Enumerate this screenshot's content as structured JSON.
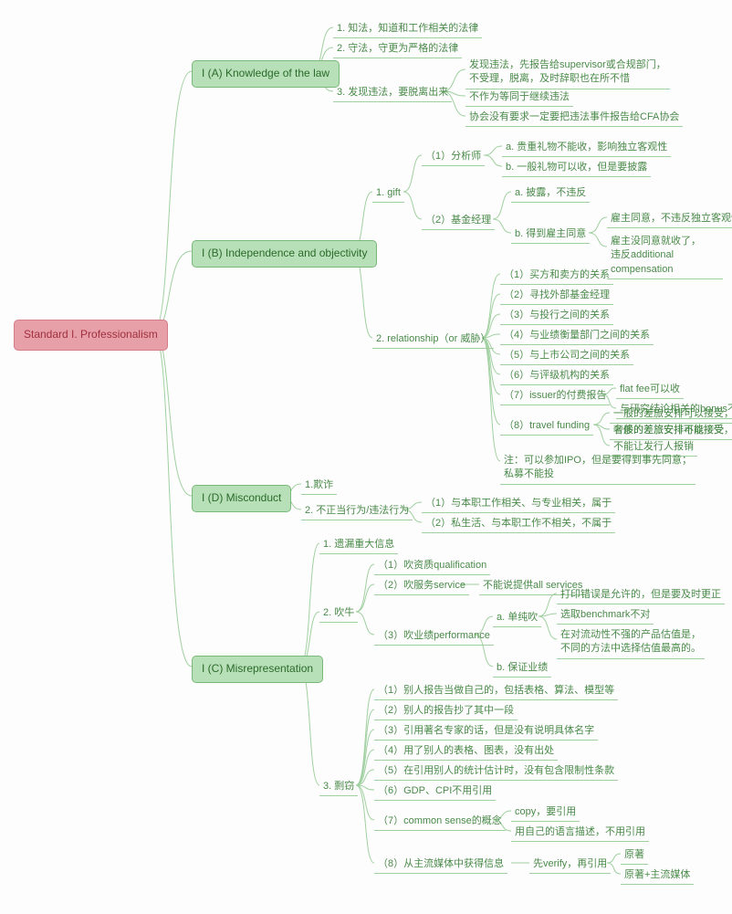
{
  "root": "Standard I. Professionalism",
  "A": {
    "title": "I (A) Knowledge of the law",
    "n1": "1. 知法，知道和工作相关的法律",
    "n2": "2. 守法，守更为严格的法律",
    "n3": "3. 发现违法，要脱离出来",
    "n3a": "发现违法，先报告给supervisor或合规部门，\n不受理，脱离，及时辞职也在所不惜",
    "n3b": "不作为等同于继续违法",
    "n3c": "协会没有要求一定要把违法事件报告给CFA协会"
  },
  "B": {
    "title": "I (B) Independence and objectivity",
    "n1": "1. gift",
    "n1_1": "（1）分析师",
    "n1_1a": "a. 贵重礼物不能收，影响独立客观性",
    "n1_1b": "b. 一般礼物可以收，但是要披露",
    "n1_2": "（2）基金经理",
    "n1_2a": "a. 披露，不违反",
    "n1_2b": "b. 得到雇主同意",
    "n1_2b1": "雇主同意，不违反独立客观性",
    "n1_2b2": "雇主没同意就收了，\n违反additional compensation",
    "n2": "2. relationship（or 威胁）",
    "n2_1": "（1）买方和卖方的关系",
    "n2_2": "（2）寻找外部基金经理",
    "n2_3": "（3）与投行之间的关系",
    "n2_4": "（4）与业绩衡量部门之间的关系",
    "n2_5": "（5）与上市公司之间的关系",
    "n2_6": "（6）与评级机构的关系",
    "n2_7": "（7）issuer的付费报告",
    "n2_7a": "flat fee可以收",
    "n2_7b": "与研究结论相关的bonus不能收",
    "n2_8": "（8）travel funding",
    "n2_8a": "一般的差旅安排可以接受，但要披露",
    "n2_8b": "奢侈的差旅安排不能接受",
    "n2_8c": "不能让发行人报销",
    "n2_9": "注：可以参加IPO，但是要得到事先同意；\n私募不能投"
  },
  "D": {
    "title": "I (D) Misconduct",
    "n1": "1.欺诈",
    "n2": "2. 不正当行为/违法行为",
    "n2_1": "（1）与本职工作相关、与专业相关，属于",
    "n2_2": "（2）私生活、与本职工作不相关，不属于"
  },
  "C": {
    "title": "I (C) Misrepresentation",
    "n1": "1. 遗漏重大信息",
    "n2": "2. 吹牛",
    "n2_1": "（1）吹资质qualification",
    "n2_2": "（2）吹服务service",
    "n2_2a": "不能说提供all services",
    "n2_3": "（3）吹业绩performance",
    "n2_3a": "a. 单纯吹",
    "n2_3a1": "打印错误是允许的，但是要及时更正",
    "n2_3a2": "选取benchmark不对",
    "n2_3a3": "在对流动性不强的产品估值是，\n不同的方法中选择估值最高的。",
    "n2_3b": "b. 保证业绩",
    "n3": "3. 剽窃",
    "n3_1": "（1）别人报告当做自己的，包括表格、算法、模型等",
    "n3_2": "（2）别人的报告抄了其中一段",
    "n3_3": "（3）引用著名专家的话，但是没有说明具体名字",
    "n3_4": "（4）用了别人的表格、图表，没有出处",
    "n3_5": "（5）在引用别人的统计估计时，没有包含限制性条款",
    "n3_6": "（6）GDP、CPI不用引用",
    "n3_7": "（7）common sense的概念",
    "n3_7a": "copy，要引用",
    "n3_7b": "用自己的语言描述，不用引用",
    "n3_8": "（8）从主流媒体中获得信息",
    "n3_8a": "先verify，再引用",
    "n3_8b": "原著",
    "n3_8c": "原著+主流媒体"
  }
}
